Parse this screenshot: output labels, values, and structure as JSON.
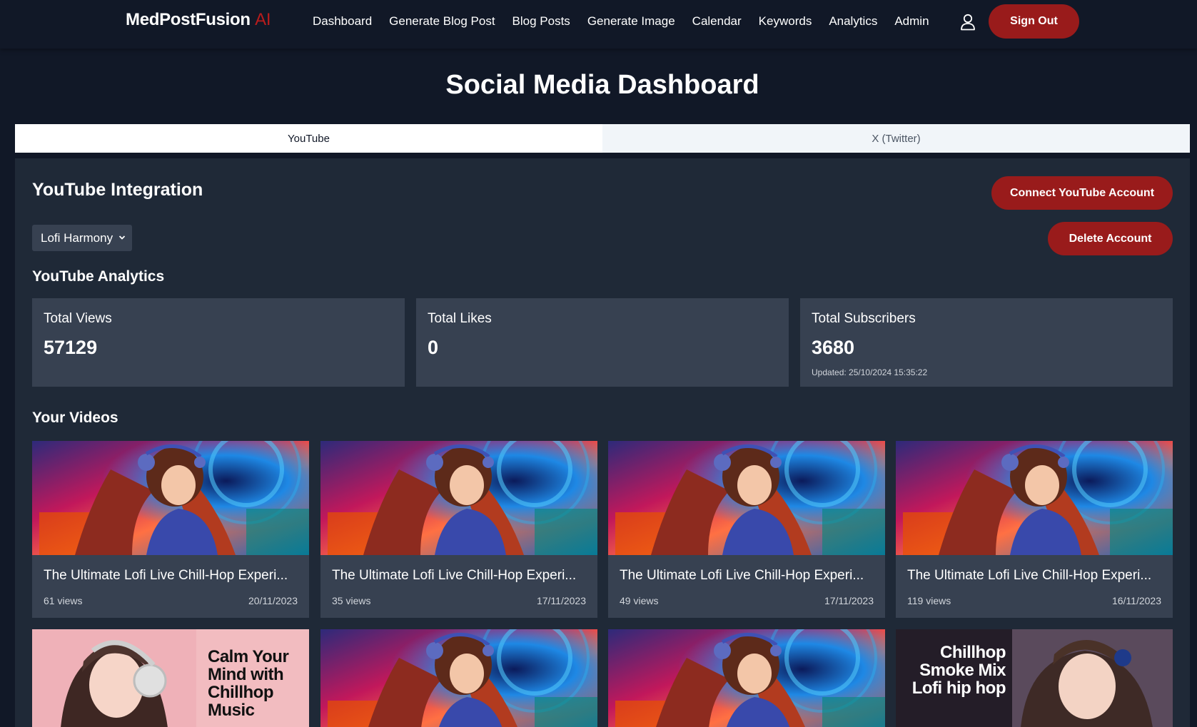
{
  "nav": {
    "brand": "MedPostFusion",
    "brand_suffix": "AI",
    "links": [
      "Dashboard",
      "Generate Blog Post",
      "Blog Posts",
      "Generate Image",
      "Calendar",
      "Keywords",
      "Analytics",
      "Admin"
    ],
    "signout": "Sign Out",
    "user_icon": "user-icon"
  },
  "page": {
    "title": "Social Media Dashboard"
  },
  "tabs": [
    {
      "label": "YouTube",
      "active": true
    },
    {
      "label": "X (Twitter)",
      "active": false
    }
  ],
  "integration": {
    "title": "YouTube Integration",
    "connect_label": "Connect YouTube Account",
    "delete_label": "Delete Account",
    "selected_account": "Lofi Harmony"
  },
  "analytics": {
    "title": "YouTube Analytics",
    "cards": [
      {
        "label": "Total Views",
        "value": "57129"
      },
      {
        "label": "Total Likes",
        "value": "0"
      },
      {
        "label": "Total Subscribers",
        "value": "3680",
        "updated": "Updated: 25/10/2024 15:35:22"
      }
    ]
  },
  "videos": {
    "title": "Your Videos",
    "items": [
      {
        "title": "The Ultimate Lofi Live Chill-Hop Experi...",
        "views": "61 views",
        "date": "20/11/2023"
      },
      {
        "title": "The Ultimate Lofi Live Chill-Hop Experi...",
        "views": "35 views",
        "date": "17/11/2023"
      },
      {
        "title": "The Ultimate Lofi Live Chill-Hop Experi...",
        "views": "49 views",
        "date": "17/11/2023"
      },
      {
        "title": "The Ultimate Lofi Live Chill-Hop Experi...",
        "views": "119 views",
        "date": "16/11/2023"
      }
    ],
    "second_row": {
      "calm_text": "Calm Your Mind with Chillhop Music",
      "chill_text": "Chillhop Smoke Mix Lofi hip hop"
    }
  },
  "colors": {
    "background": "#111827",
    "panel": "#1f2937",
    "card": "#374151",
    "accent_red": "#991b1b"
  }
}
